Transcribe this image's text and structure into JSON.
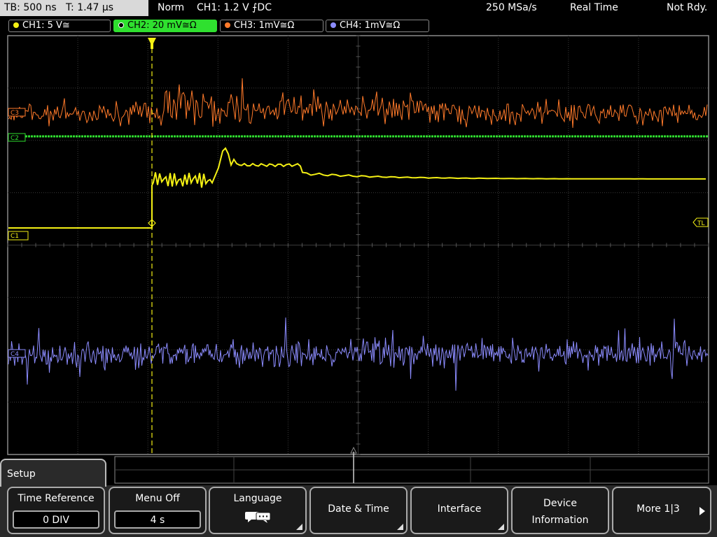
{
  "status": {
    "timebase": "TB: 500 ns   T: 1.47 µs",
    "mode": "Norm",
    "trigger": "CH1: 1.2 V ⨍DC",
    "samplerate": "250 MSa/s",
    "acq": "Real Time",
    "state": "Not Rdy."
  },
  "channels": [
    {
      "label": "CH1: 5 V≅",
      "color": "#f4f014"
    },
    {
      "label": "CH2: 20 mV≅Ω",
      "color": "#2fe02f"
    },
    {
      "label": "CH3: 1mV≅Ω",
      "color": "#ff7a2a"
    },
    {
      "label": "CH4: 1mV≅Ω",
      "color": "#8c8cff"
    }
  ],
  "markers": {
    "ch3": "C3",
    "ch2": "C2",
    "ch1": "C1",
    "ch4": "C4",
    "trig_level": "TL"
  },
  "menu": {
    "title": "Setup",
    "time_ref_title": "Time Reference",
    "time_ref_value": "0 DIV",
    "menu_off_title": "Menu Off",
    "menu_off_value": "4 s",
    "language": "Language",
    "datetime": "Date & Time",
    "interface": "Interface",
    "device_l1": "Device",
    "device_l2": "Information",
    "more": "More 1|3"
  }
}
